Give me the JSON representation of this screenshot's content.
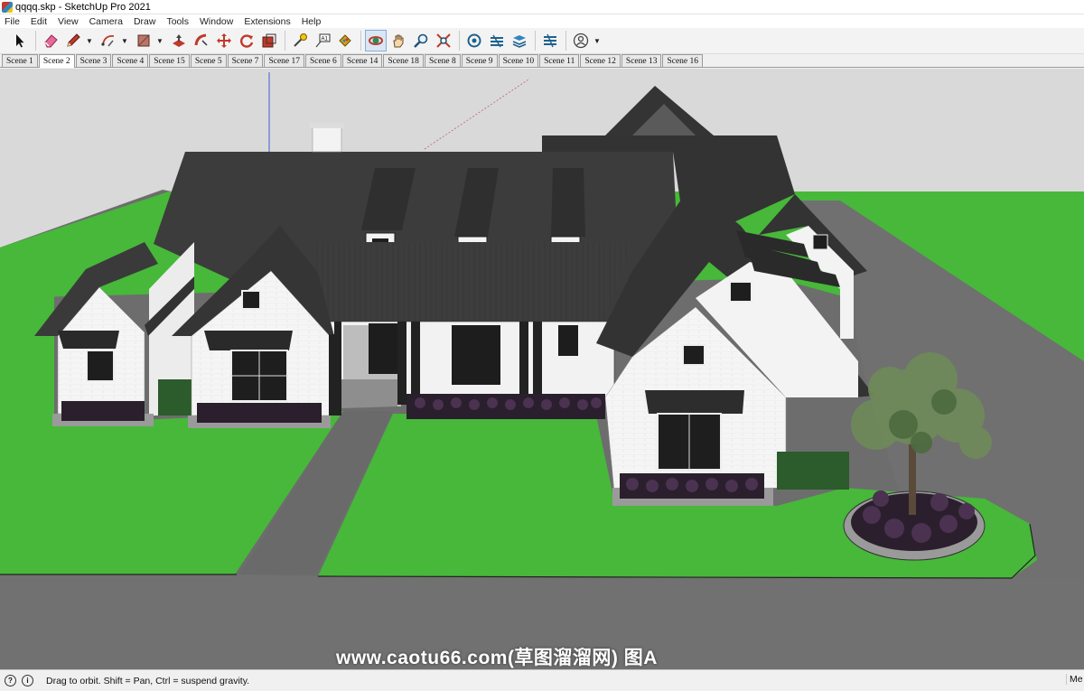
{
  "window": {
    "title": "qqqq.skp - SketchUp Pro 2021",
    "app_icon": "sketchup-logo-icon"
  },
  "menu": [
    "File",
    "Edit",
    "View",
    "Camera",
    "Draw",
    "Tools",
    "Window",
    "Extensions",
    "Help"
  ],
  "toolbar": {
    "tools": [
      {
        "name": "select-tool",
        "icon": "arrow-cursor-icon"
      },
      {
        "name": "eraser-tool",
        "icon": "eraser-icon"
      },
      {
        "name": "pencil-tool",
        "icon": "pencil-icon",
        "dropdown": true
      },
      {
        "name": "arc-tool",
        "icon": "arc-icon",
        "dropdown": true
      },
      {
        "name": "rectangle-tool",
        "icon": "rectangle-icon",
        "dropdown": true
      },
      {
        "name": "push-pull-tool",
        "icon": "push-pull-icon"
      },
      {
        "name": "follow-me-tool",
        "icon": "follow-me-icon"
      },
      {
        "name": "move-tool",
        "icon": "move-icon"
      },
      {
        "name": "rotate-tool",
        "icon": "rotate-icon"
      },
      {
        "name": "scale-tool",
        "icon": "scale-icon"
      },
      {
        "name": "tape-measure-tool",
        "icon": "tape-measure-icon"
      },
      {
        "name": "text-tool",
        "icon": "text-icon"
      },
      {
        "name": "paint-bucket-tool",
        "icon": "paint-bucket-icon"
      },
      {
        "name": "orbit-tool",
        "icon": "orbit-icon",
        "active": true
      },
      {
        "name": "pan-tool",
        "icon": "hand-icon"
      },
      {
        "name": "zoom-tool",
        "icon": "magnifier-icon"
      },
      {
        "name": "zoom-extents-tool",
        "icon": "zoom-extents-icon"
      },
      {
        "name": "warehouse-tool",
        "icon": "3d-warehouse-icon"
      },
      {
        "name": "extension-warehouse-tool",
        "icon": "extension-warehouse-icon"
      },
      {
        "name": "layout-tool",
        "icon": "layers-icon"
      },
      {
        "name": "extension-manager-tool",
        "icon": "extension-manager-icon"
      },
      {
        "name": "account-tool",
        "icon": "user-account-icon",
        "dropdown": true
      }
    ]
  },
  "scenes": {
    "active_index": 1,
    "tabs": [
      "Scene 1",
      "Scene 2",
      "Scene 3",
      "Scene 4",
      "Scene 15",
      "Scene 5",
      "Scene 7",
      "Scene 17",
      "Scene 6",
      "Scene 14",
      "Scene 18",
      "Scene 8",
      "Scene 9",
      "Scene 10",
      "Scene 11",
      "Scene 12",
      "Scene 13",
      "Scene 16"
    ]
  },
  "viewport": {
    "watermark": "www.caotu66.com(草图溜溜网) 图A",
    "colors": {
      "sky": "#d9d9d9",
      "lawn": "#46b83a",
      "paving": "#6e6e6e",
      "roof": "#3a3a3a",
      "wall": "#f4f4f4",
      "trim": "#1c1c1c",
      "axis_blue": "#3f5fd8"
    }
  },
  "status": {
    "hint": "Drag to orbit. Shift = Pan, Ctrl = suspend gravity.",
    "measurements_label": "Me"
  }
}
